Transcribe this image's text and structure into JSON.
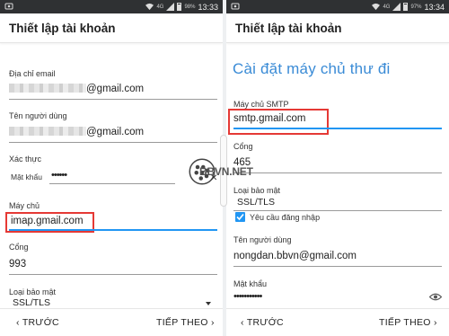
{
  "status_left": {
    "network": "4G",
    "battery": "98%",
    "time": "13:33"
  },
  "status_right": {
    "network": "4G",
    "battery": "97%",
    "time": "13:34"
  },
  "left": {
    "title": "Thiết lập tài khoản",
    "email_label": "Địa chỉ email",
    "email_suffix": "@gmail.com",
    "username_label": "Tên người dùng",
    "username_suffix": "@gmail.com",
    "auth_label": "Xác thực",
    "password_label": "Mật khẩu",
    "password_value": "••••••",
    "server_label": "Máy chủ",
    "server_value": "imap.gmail.com",
    "port_label": "Cổng",
    "port_value": "993",
    "security_label": "Loại bảo mật",
    "security_value": "SSL/TLS",
    "back_label": "TRƯỚC",
    "next_label": "TIẾP THEO"
  },
  "right": {
    "title": "Thiết lập tài khoản",
    "subheading": "Cài đặt máy chủ thư đi",
    "smtp_label": "Máy chủ SMTP",
    "smtp_value": "smtp.gmail.com",
    "port_label": "Cổng",
    "port_value": "465",
    "security_label": "Loại bảo mật",
    "security_value": "SSL/TLS",
    "require_login_label": "Yêu cầu đăng nhập",
    "require_login_checked": true,
    "username_label": "Tên người dùng",
    "username_value": "nongdan.bbvn@gmail.com",
    "password_label": "Mật khẩu",
    "password_value": "•••••••••••",
    "back_label": "TRƯỚC",
    "next_label": "TIẾP THEO"
  },
  "watermark": {
    "text": "BBVN.NET"
  },
  "colors": {
    "accent": "#2196f3",
    "highlight": "#e53935",
    "heading": "#3a8bd6",
    "statusbar": "#2f3133"
  },
  "icons": {
    "checkbox": "check-icon",
    "reveal": "eye-icon",
    "back": "chevron-left-icon",
    "next": "chevron-right-icon"
  }
}
